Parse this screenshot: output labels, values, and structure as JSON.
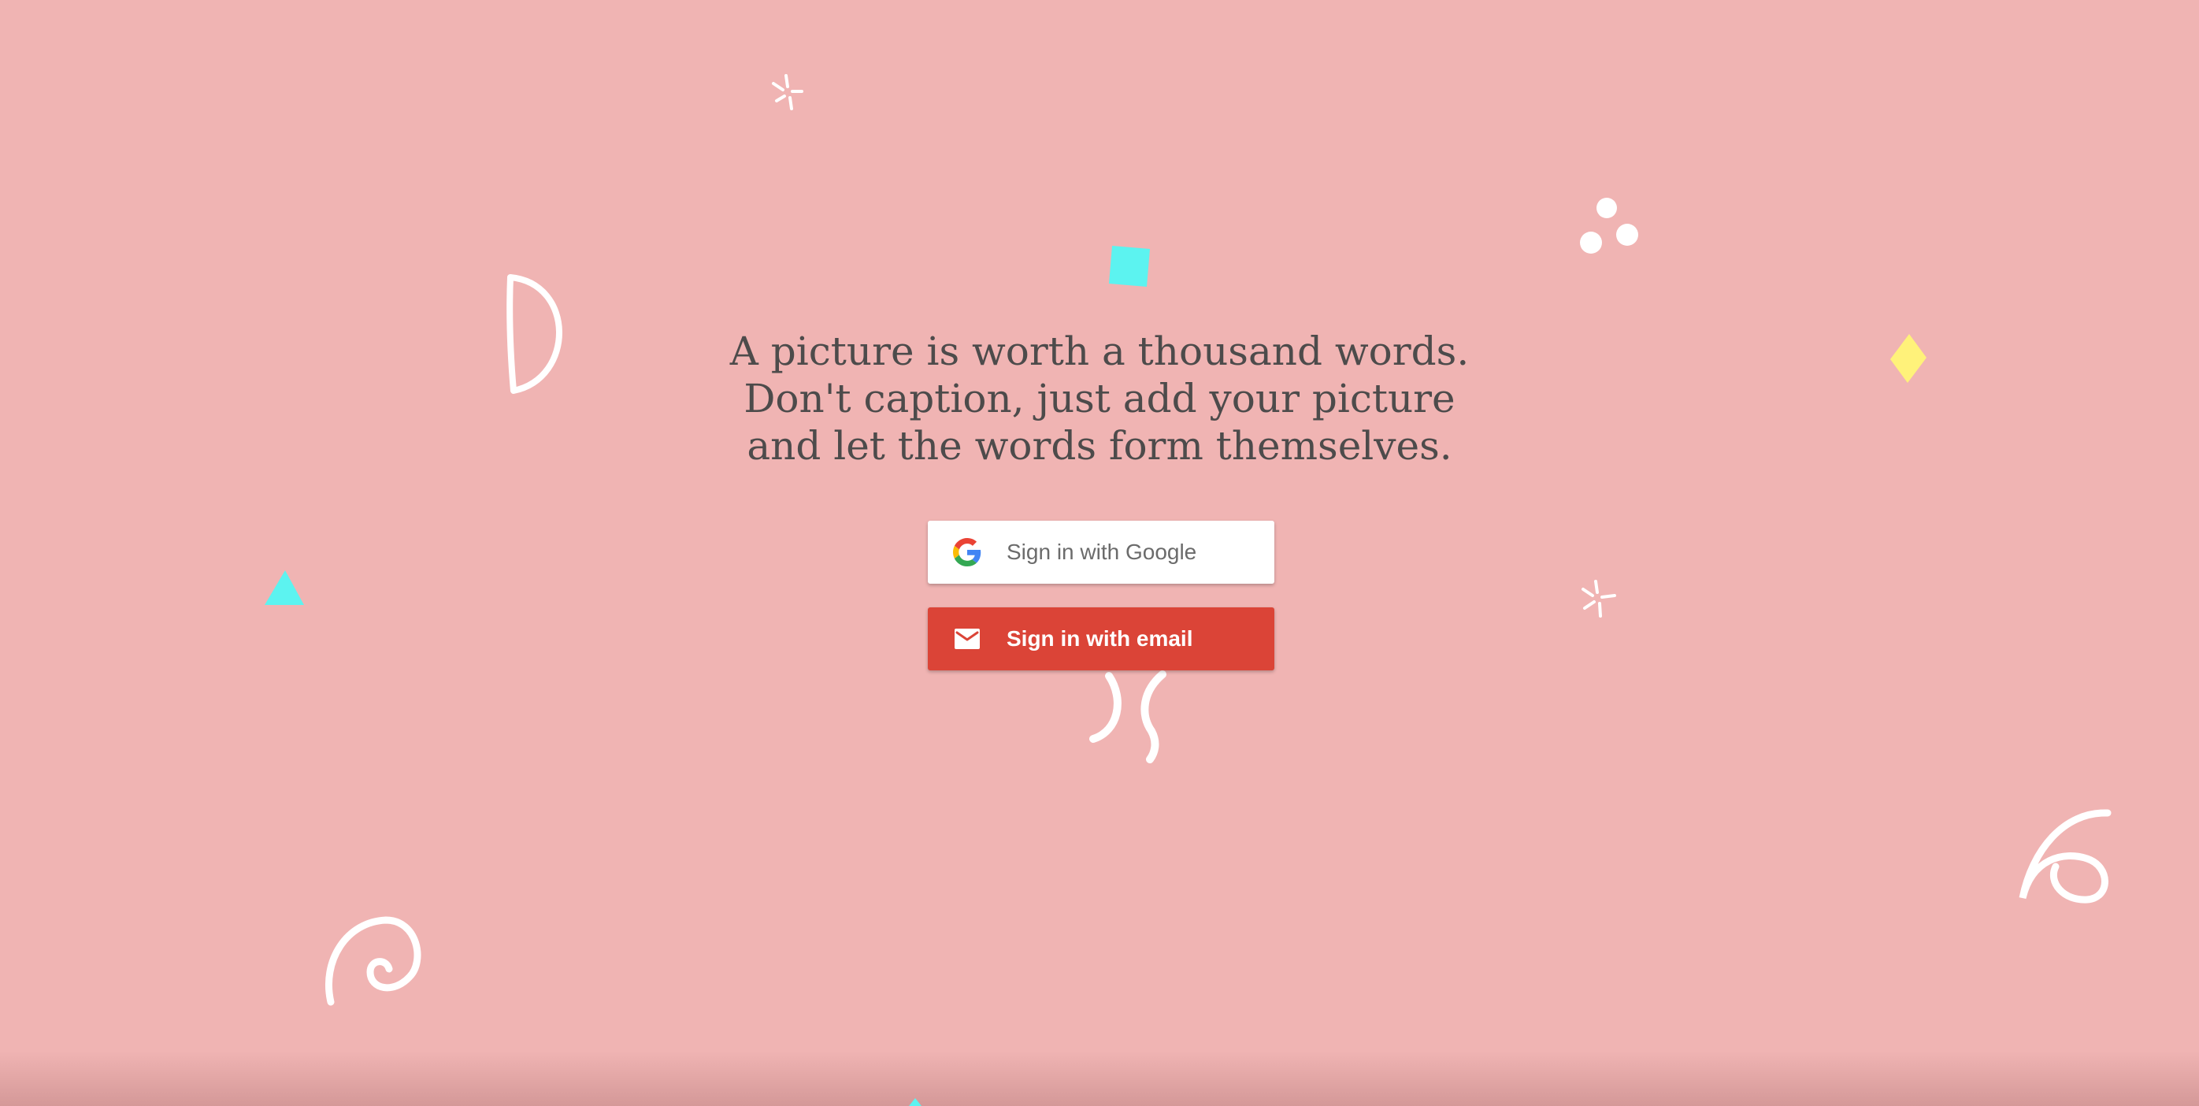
{
  "tagline": {
    "line1": "A picture is worth a thousand words.",
    "line2": "Don't caption, just add your picture",
    "line3": "and let the words form themselves."
  },
  "buttons": {
    "google_label": "Sign in with Google",
    "email_label": "Sign in with email"
  },
  "icons": {
    "google": "google-g-icon",
    "email": "mail-icon"
  },
  "colors": {
    "background": "#f0b4b3",
    "text": "#4d4b4b",
    "email_button": "#db4437",
    "google_button": "#ffffff",
    "accent_cyan": "#5cf3f0",
    "accent_yellow": "#fff27a",
    "doodle_white": "#ffffff"
  }
}
